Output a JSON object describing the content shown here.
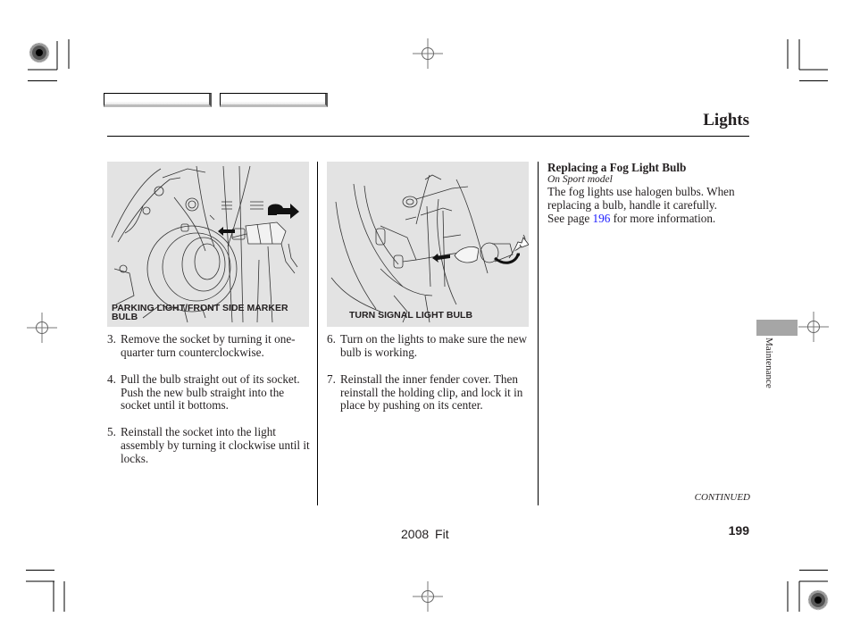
{
  "page": {
    "section_title": "Lights",
    "page_number": "199",
    "footer_model": "2008  Fit",
    "continued_label": "CONTINUED",
    "side_tab_label": "Maintenance",
    "side_tab_color": "#a6a6a6"
  },
  "nav_buttons": [
    {
      "label": "",
      "icon": "nav-button-blank"
    },
    {
      "label": "",
      "icon": "nav-button-blank"
    }
  ],
  "figures": [
    {
      "caption": "PARKING LIGHT/FRONT SIDE MARKER BULB",
      "caption_line1": "PARKING LIGHT/FRONT SIDE MARKER",
      "caption_line2": "BULB",
      "background": "#e3e3e3"
    },
    {
      "caption": "TURN SIGNAL LIGHT BULB",
      "background": "#e3e3e3"
    }
  ],
  "column1_steps": [
    {
      "num": "3.",
      "text": "Remove the socket by turning it one-quarter turn counterclockwise."
    },
    {
      "num": "4.",
      "text": "Pull the bulb straight out of its socket. Push the new bulb straight into the socket until it bottoms."
    },
    {
      "num": "5.",
      "text": "Reinstall the socket into the light assembly by turning it clockwise until it locks."
    }
  ],
  "column2_steps": [
    {
      "num": "6.",
      "text": "Turn on the lights to make sure the new bulb is working."
    },
    {
      "num": "7.",
      "text": "Reinstall the inner fender cover. Then reinstall the holding clip, and lock it in place by pushing on its center."
    }
  ],
  "sidebar": {
    "heading": "Replacing a Fog Light Bulb",
    "subheading": "On Sport model",
    "body_before_link": "The fog lights use halogen bulbs. When replacing a bulb, handle it carefully. See page ",
    "link_text": "196",
    "body_after_link": " for more information.",
    "link_color": "#1a1aff"
  }
}
